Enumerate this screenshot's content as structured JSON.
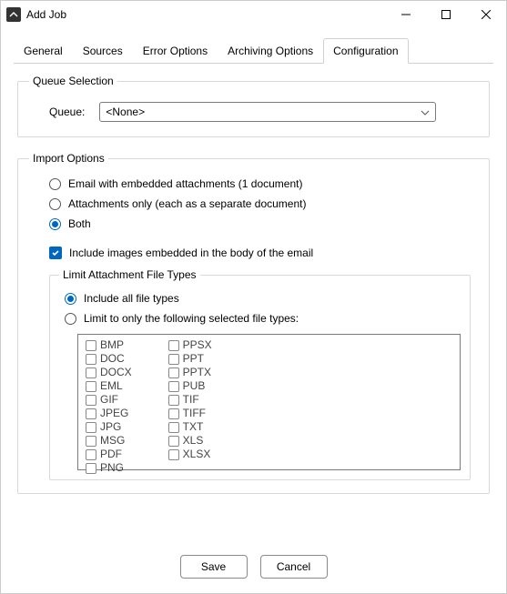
{
  "window": {
    "title": "Add Job"
  },
  "tabs": {
    "items": [
      {
        "label": "General"
      },
      {
        "label": "Sources"
      },
      {
        "label": "Error Options"
      },
      {
        "label": "Archiving Options"
      },
      {
        "label": "Configuration"
      }
    ]
  },
  "queue_section": {
    "legend": "Queue Selection",
    "label": "Queue:",
    "value": "<None>"
  },
  "import_section": {
    "legend": "Import Options",
    "opt_email": "Email with embedded attachments (1 document)",
    "opt_attachments": "Attachments only (each as a separate document)",
    "opt_both": "Both",
    "include_images": "Include images embedded in the body of the email",
    "limit_group": {
      "legend": "Limit Attachment File Types",
      "opt_include_all": "Include all file types",
      "opt_limit": "Limit to only the following selected file types:",
      "col1": [
        "BMP",
        "DOC",
        "DOCX",
        "EML",
        "GIF",
        "JPEG",
        "JPG",
        "MSG",
        "PDF",
        "PNG"
      ],
      "col2": [
        "PPSX",
        "PPT",
        "PPTX",
        "PUB",
        "TIF",
        "TIFF",
        "TXT",
        "XLS",
        "XLSX"
      ]
    }
  },
  "footer": {
    "save": "Save",
    "cancel": "Cancel"
  }
}
